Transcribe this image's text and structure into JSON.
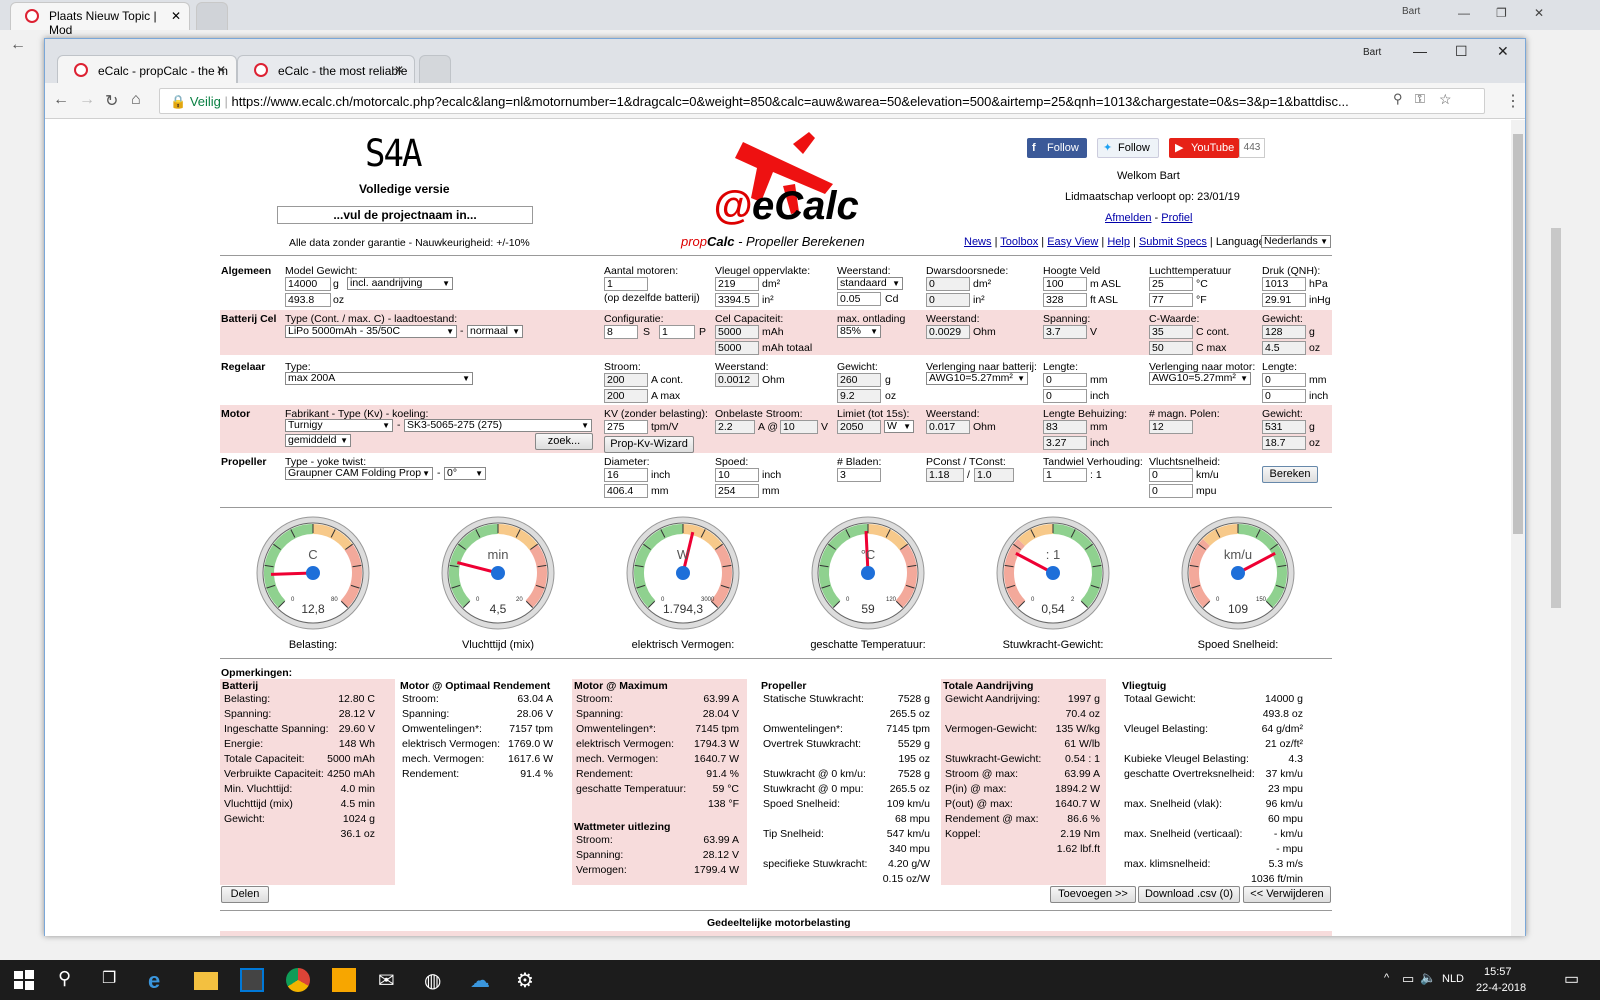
{
  "bg_window": {
    "tab1": "Plaats Nieuw Topic | Mod",
    "user": "Bart"
  },
  "window": {
    "user": "Bart",
    "tabs": [
      {
        "label": "eCalc - propCalc - the m"
      },
      {
        "label": "eCalc - the most reliable"
      }
    ],
    "secure": "Veilig",
    "url": "https://www.ecalc.ch/motorcalc.php?ecalc&lang=nl&motornumber=1&dragcalc=0&weight=850&calc=auw&warea=50&elevation=500&airtemp=25&qnh=1013&chargestate=0&s=3&p=1&battdisc..."
  },
  "header": {
    "model_code": "S4A",
    "version": "Volledige versie",
    "project_placeholder": "...vul de projectnaam in...",
    "disclaimer": "Alle data zonder garantie - Nauwkeurigheid: +/-10%",
    "logo": "eCalc",
    "subtitle_prefix": "prop",
    "subtitle_bold": "Calc",
    "subtitle_rest": " - Propeller Berekenen",
    "fb": "Follow",
    "tw": "Follow",
    "yt": "YouTube",
    "yt_count": "443",
    "welcome": "Welkom Bart",
    "membership": "Lidmaatschap verloopt op: 23/01/19",
    "logout": "Afmelden",
    "sep": "-",
    "profile": "Profiel",
    "nav": [
      "News",
      "Toolbox",
      "Easy View",
      "Help",
      "Submit Specs"
    ],
    "language_label": "Language:",
    "language": "Nederlands"
  },
  "form": {
    "algemeen": {
      "title": "Algemeen",
      "weight_label": "Model Gewicht:",
      "weight_g": "14000",
      "unit_g": "g",
      "incl": "incl. aandrijving",
      "weight_oz": "493.8",
      "unit_oz": "oz",
      "motors_label": "Aantal motoren:",
      "motors": "1",
      "motors_note": "(op dezelfde batterij)",
      "wing_label": "Vleugel oppervlakte:",
      "wing_dm": "219",
      "unit_dm2": "dm²",
      "wing_in": "3394.5",
      "unit_in2": "in²",
      "drag_label": "Weerstand:",
      "drag_sel": "standaard",
      "cd": "0.05",
      "cd_unit": "Cd",
      "cross_label": "Dwarsdoorsnede:",
      "cross_dm": "0",
      "cross_in": "0",
      "elev_label": "Hoogte Veld",
      "elev_m": "100",
      "unit_masl": "m ASL",
      "elev_ft": "328",
      "unit_ftasl": "ft ASL",
      "temp_label": "Luchttemperatuur",
      "temp_c": "25",
      "unit_c": "°C",
      "temp_f": "77",
      "unit_f": "°F",
      "qnh_label": "Druk (QNH):",
      "qnh_hpa": "1013",
      "unit_hpa": "hPa",
      "qnh_inhg": "29.91",
      "unit_inhg": "inHg"
    },
    "batterij": {
      "title": "Batterij Cel",
      "type_label": "Type (Cont. / max. C) - laadtoestand:",
      "type": "LiPo 5000mAh - 35/50C",
      "dash": "-",
      "state": "normaal",
      "config_label": "Configuratie:",
      "s": "8",
      "s_unit": "S",
      "p": "1",
      "p_unit": "P",
      "cap_label": "Cel Capaciteit:",
      "cap": "5000",
      "cap_unit": "mAh",
      "cap_total": "5000",
      "cap_total_unit": "mAh totaal",
      "disch_label": "max. ontlading",
      "disch": "85%",
      "res_label": "Weerstand:",
      "res": "0.0029",
      "res_unit": "Ohm",
      "volt_label": "Spanning:",
      "volt": "3.7",
      "volt_unit": "V",
      "c_label": "C-Waarde:",
      "c_cont": "35",
      "c_cont_unit": "C cont.",
      "c_max": "50",
      "c_max_unit": "C max",
      "w_label": "Gewicht:",
      "w_g": "128",
      "w_oz": "4.5"
    },
    "regelaar": {
      "title": "Regelaar",
      "type_label": "Type:",
      "type": "max 200A",
      "cur_label": "Stroom:",
      "cur_cont": "200",
      "cur_cont_unit": "A cont.",
      "cur_max": "200",
      "cur_max_unit": "A max",
      "res_label": "Weerstand:",
      "res": "0.0012",
      "res_unit": "Ohm",
      "w_label": "Gewicht:",
      "w_g": "260",
      "w_oz": "9.2",
      "ext_bat_label": "Verlenging naar batterij:",
      "ext_bat": "AWG10=5.27mm²",
      "len_label": "Lengte:",
      "len_mm": "0",
      "len_in": "0",
      "unit_mm": "mm",
      "unit_inch": "inch",
      "ext_mot_label": "Verlenging naar motor:",
      "ext_mot": "AWG10=5.27mm²",
      "len2_mm": "0",
      "len2_in": "0"
    },
    "motor": {
      "title": "Motor",
      "mfr_label": "Fabrikant - Type (Kv) - koeling:",
      "mfr": "Turnigy",
      "model": "SK3-5065-275 (275)",
      "cool": "gemiddeld",
      "search": "zoek...",
      "kv_label": "KV (zonder belasting):",
      "kv": "275",
      "kv_unit": "tpm/V",
      "wizard": "Prop-Kv-Wizard",
      "noload_label": "Onbelaste Stroom:",
      "noload": "2.2",
      "at": "A @",
      "noload_v": "10",
      "v_unit": "V",
      "limit_label": "Limiet (tot 15s):",
      "limit": "2050",
      "limit_unit": "W",
      "res_label": "Weerstand:",
      "res": "0.017",
      "len_label": "Lengte Behuizing:",
      "len_mm": "83",
      "len_in": "3.27",
      "poles_label": "# magn. Polen:",
      "poles": "12",
      "w_label": "Gewicht:",
      "w_g": "531",
      "w_oz": "18.7"
    },
    "propeller": {
      "title": "Propeller",
      "type_label": "Type - yoke twist:",
      "type": "Graupner CAM Folding Prop",
      "twist": "0°",
      "dia_label": "Diameter:",
      "dia_in": "16",
      "dia_mm": "406.4",
      "pitch_label": "Spoed:",
      "pitch_in": "10",
      "pitch_mm": "254",
      "blades_label": "# Bladen:",
      "blades": "3",
      "pconst_label": "PConst / TConst:",
      "pconst": "1.18",
      "slash": "/",
      "tconst": "1.0",
      "gear_label": "Tandwiel Verhouding:",
      "gear": "1",
      "gear_ratio": ": 1",
      "speed_label": "Vluchtsnelheid:",
      "speed_kmh": "0",
      "unit_kmh": "km/u",
      "speed_mph": "0",
      "unit_mph": "mpu",
      "calc": "Bereken"
    }
  },
  "gauges": [
    {
      "unit": "C",
      "value": "12,8",
      "label": "Belasting:",
      "fraction": 0.16,
      "ticks": [
        "0",
        "80"
      ]
    },
    {
      "unit": "min",
      "value": "4,5",
      "label": "Vluchttijd (mix)",
      "fraction": 0.22,
      "ticks": [
        "0",
        "20"
      ]
    },
    {
      "unit": "W",
      "value": "1.794,3",
      "label": "elektrisch Vermogen:",
      "fraction": 0.55,
      "ticks": [
        "0",
        "3000"
      ]
    },
    {
      "unit": "°C",
      "value": "59",
      "label": "geschatte Temperatuur:",
      "fraction": 0.49,
      "ticks": [
        "0",
        "120"
      ]
    },
    {
      "unit": ": 1",
      "value": "0,54",
      "label": "Stuwkracht-Gewicht:",
      "fraction": 0.27,
      "ticks": [
        "0",
        "2"
      ]
    },
    {
      "unit": "km/u",
      "value": "109",
      "label": "Spoed Snelheid:",
      "fraction": 0.73,
      "ticks": [
        "0",
        "150"
      ]
    }
  ],
  "results": {
    "remarks": "Opmerkingen:",
    "batterij": {
      "title": "Batterij",
      "rows": [
        [
          "Belasting:",
          "12.80 C"
        ],
        [
          "Spanning:",
          "28.12 V"
        ],
        [
          "Ingeschatte Spanning:",
          "29.60 V"
        ],
        [
          "Energie:",
          "148 Wh"
        ],
        [
          "Totale Capaciteit:",
          "5000 mAh"
        ],
        [
          "Verbruikte Capaciteit:",
          "4250 mAh"
        ],
        [
          "Min. Vluchttijd:",
          "4.0 min"
        ],
        [
          "Vluchttijd (mix)",
          "4.5 min"
        ],
        [
          "Gewicht:",
          "1024 g"
        ],
        [
          "",
          "36.1 oz"
        ]
      ]
    },
    "optimaal": {
      "title": "Motor @ Optimaal Rendement",
      "rows": [
        [
          "Stroom:",
          "63.04 A"
        ],
        [
          "Spanning:",
          "28.06 V"
        ],
        [
          "Omwentelingen*:",
          "7157 tpm"
        ],
        [
          "elektrisch Vermogen:",
          "1769.0 W"
        ],
        [
          "mech. Vermogen:",
          "1617.6 W"
        ],
        [
          "Rendement:",
          "91.4 %"
        ]
      ]
    },
    "maximum": {
      "title": "Motor @ Maximum",
      "rows": [
        [
          "Stroom:",
          "63.99 A"
        ],
        [
          "Spanning:",
          "28.04 V"
        ],
        [
          "Omwentelingen*:",
          "7145 tpm"
        ],
        [
          "elektrisch Vermogen:",
          "1794.3 W"
        ],
        [
          "mech. Vermogen:",
          "1640.7 W"
        ],
        [
          "Rendement:",
          "91.4 %"
        ],
        [
          "geschatte Temperatuur:",
          "59 °C"
        ],
        [
          "",
          "138 °F"
        ]
      ]
    },
    "wattmeter": {
      "title": "Wattmeter uitlezing",
      "rows": [
        [
          "Stroom:",
          "63.99 A"
        ],
        [
          "Spanning:",
          "28.12 V"
        ],
        [
          "Vermogen:",
          "1799.4 W"
        ]
      ]
    },
    "propeller": {
      "title": "Propeller",
      "rows": [
        [
          "Statische Stuwkracht:",
          "7528 g"
        ],
        [
          "",
          "265.5 oz"
        ],
        [
          "Omwentelingen*:",
          "7145 tpm"
        ],
        [
          "Overtrek Stuwkracht:",
          "5529 g"
        ],
        [
          "",
          "195 oz"
        ],
        [
          "Stuwkracht @ 0 km/u:",
          "7528 g"
        ],
        [
          "Stuwkracht @ 0 mpu:",
          "265.5 oz"
        ],
        [
          "Spoed Snelheid:",
          "109 km/u"
        ],
        [
          "",
          "68 mpu"
        ],
        [
          "Tip Snelheid:",
          "547 km/u"
        ],
        [
          "",
          "340 mpu"
        ],
        [
          "specifieke Stuwkracht:",
          "4.20 g/W"
        ],
        [
          "",
          "0.15 oz/W"
        ]
      ]
    },
    "aandrijving": {
      "title": "Totale Aandrijving",
      "rows": [
        [
          "Gewicht Aandrijving:",
          "1997 g"
        ],
        [
          "",
          "70.4 oz"
        ],
        [
          "Vermogen-Gewicht:",
          "135 W/kg"
        ],
        [
          "",
          "61 W/lb"
        ],
        [
          "Stuwkracht-Gewicht:",
          "0.54 : 1"
        ],
        [
          "Stroom @ max:",
          "63.99 A"
        ],
        [
          "P(in) @ max:",
          "1894.2 W"
        ],
        [
          "P(out) @ max:",
          "1640.7 W"
        ],
        [
          "Rendement @ max:",
          "86.6 %"
        ],
        [
          "Koppel:",
          "2.19 Nm"
        ],
        [
          "",
          "1.62 lbf.ft"
        ]
      ]
    },
    "vliegtuig": {
      "title": "Vliegtuig",
      "rows": [
        [
          "Totaal Gewicht:",
          "14000 g"
        ],
        [
          "",
          "493.8 oz"
        ],
        [
          "Vleugel Belasting:",
          "64 g/dm²"
        ],
        [
          "",
          "21 oz/ft²"
        ],
        [
          "Kubieke Vleugel Belasting:",
          "4.3"
        ],
        [
          "geschatte Overtreksnelheid:",
          "37 km/u"
        ],
        [
          "",
          "23 mpu"
        ],
        [
          "max. Snelheid (vlak):",
          "96 km/u"
        ],
        [
          "",
          "60 mpu"
        ],
        [
          "max. Snelheid (verticaal):",
          "- km/u"
        ],
        [
          "",
          "- mpu"
        ],
        [
          "max. klimsnelheid:",
          "5.3 m/s"
        ],
        [
          "",
          "1036 ft/min"
        ]
      ]
    },
    "share": "Delen",
    "add": "Toevoegen >>",
    "download": "Download .csv (0)",
    "remove": "<< Verwijderen",
    "partial": "Gedeeltelijke motorbelasting"
  },
  "taskbar": {
    "lang": "NLD",
    "time": "15:57",
    "date": "22-4-2018"
  }
}
